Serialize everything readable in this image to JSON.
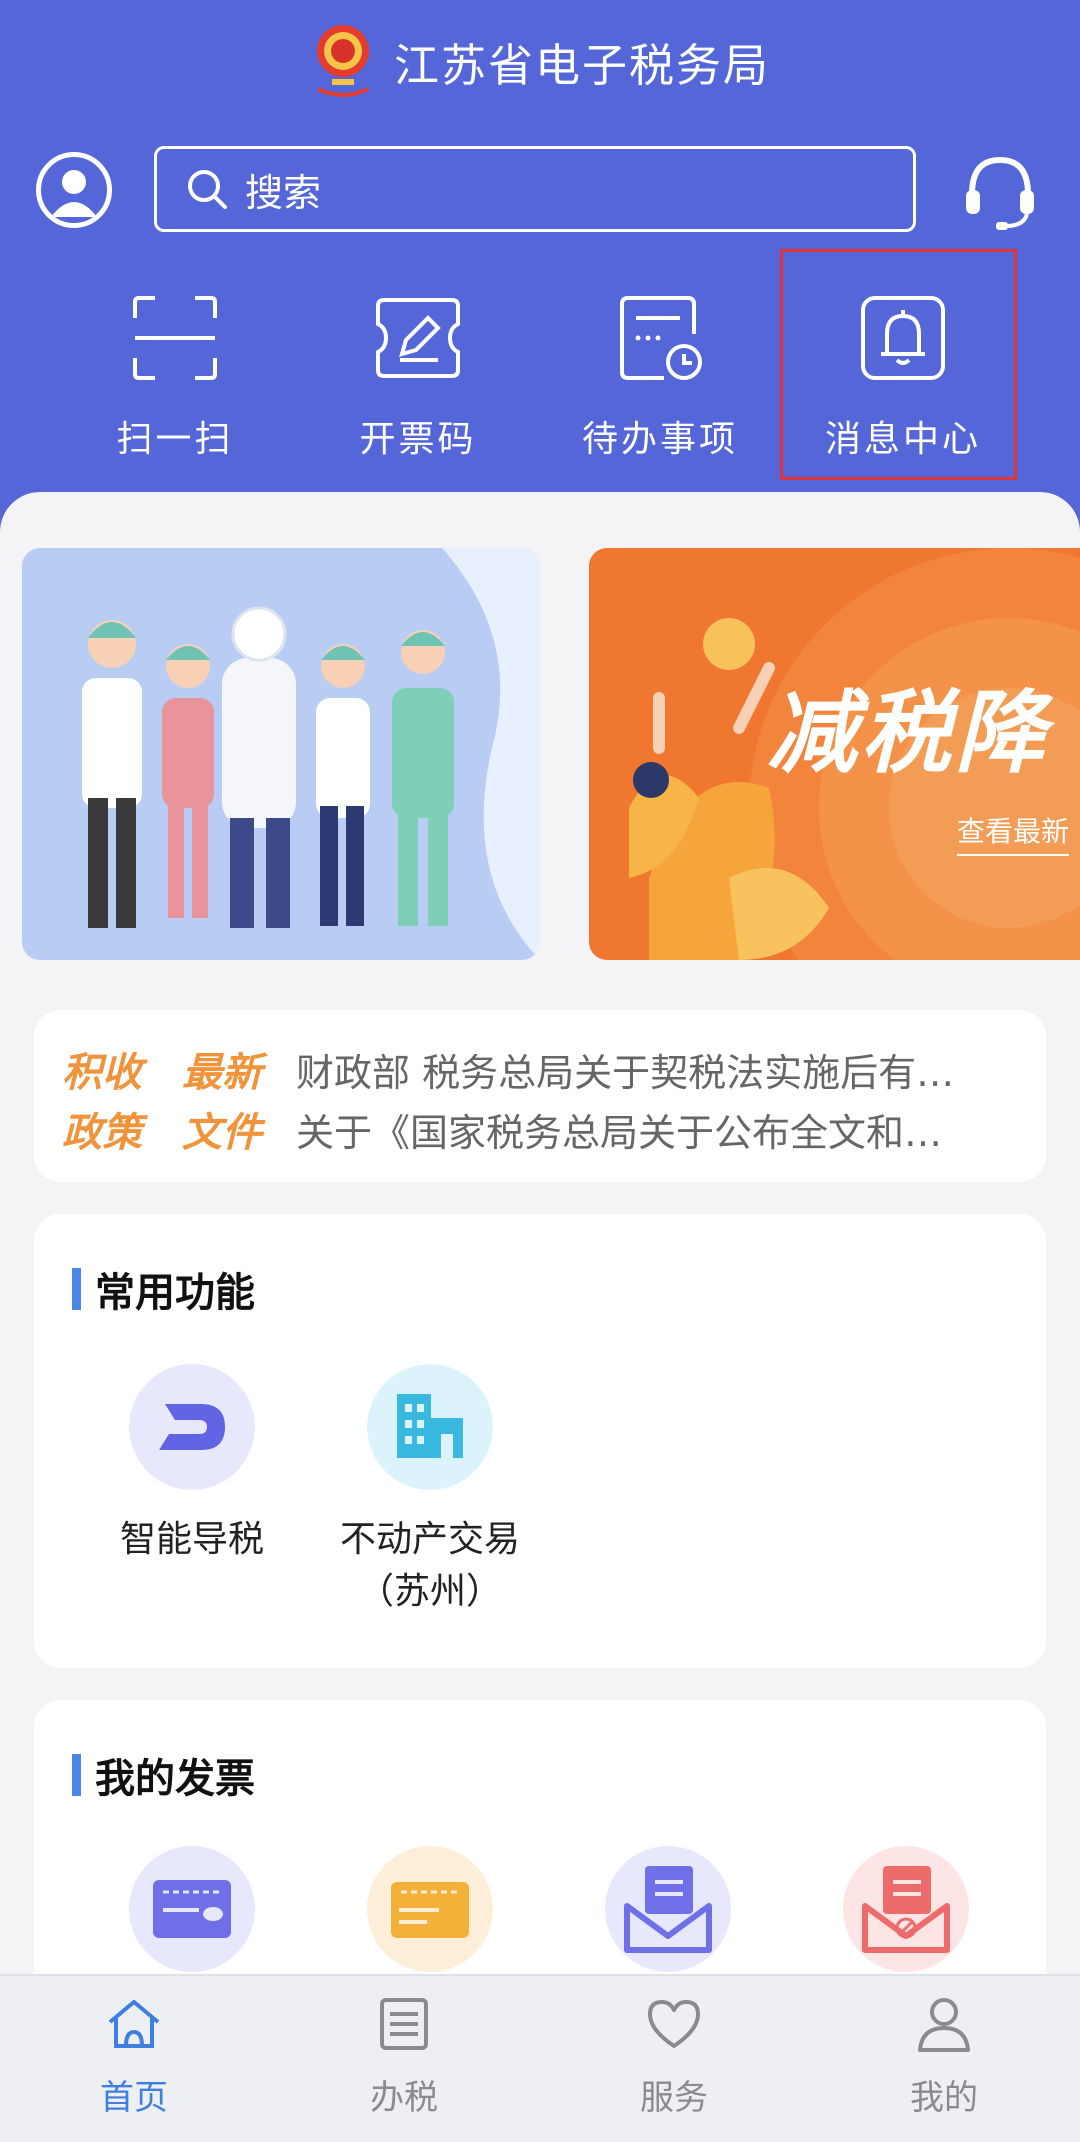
{
  "header": {
    "title": "江苏省电子税务局"
  },
  "search": {
    "label": "搜索"
  },
  "quick_actions": [
    {
      "label": "扫一扫",
      "icon": "scan-icon"
    },
    {
      "label": "开票码",
      "icon": "invoice-code-icon"
    },
    {
      "label": "待办事项",
      "icon": "todo-icon"
    },
    {
      "label": "消息中心",
      "icon": "bell-icon"
    }
  ],
  "banners": [
    {
      "headline": "",
      "link": ""
    },
    {
      "headline": "减税降",
      "link": "查看最新"
    }
  ],
  "news": {
    "badge_left_top": "积收",
    "badge_left_bottom": "政策",
    "badge_right_top": "最新",
    "badge_right_bottom": "文件",
    "items": [
      "财政部 税务总局关于契税法实施后有…",
      "关于《国家税务总局关于公布全文和…"
    ]
  },
  "common_functions": {
    "title": "常用功能",
    "items": [
      {
        "label": "智能导税",
        "icon": "smart-tax-guide-icon"
      },
      {
        "label": "不动产交易\n（苏州）",
        "icon": "real-estate-icon"
      }
    ]
  },
  "my_invoices": {
    "title": "我的发票",
    "items": [
      {
        "icon": "invoice-card-icon"
      },
      {
        "icon": "invoice-agent-icon"
      },
      {
        "icon": "invoice-mail-icon"
      },
      {
        "icon": "invoice-cancel-icon"
      }
    ]
  },
  "tabbar": [
    {
      "label": "首页",
      "icon": "home-icon",
      "active": true
    },
    {
      "label": "办税",
      "icon": "list-icon",
      "active": false
    },
    {
      "label": "服务",
      "icon": "heart-icon",
      "active": false
    },
    {
      "label": "我的",
      "icon": "user-icon",
      "active": false
    }
  ],
  "colors": {
    "header_bg": "#5566d9",
    "highlight_border": "#e0343b",
    "accent_blue": "#3f7fe0",
    "news_orange": "#f0933a"
  }
}
